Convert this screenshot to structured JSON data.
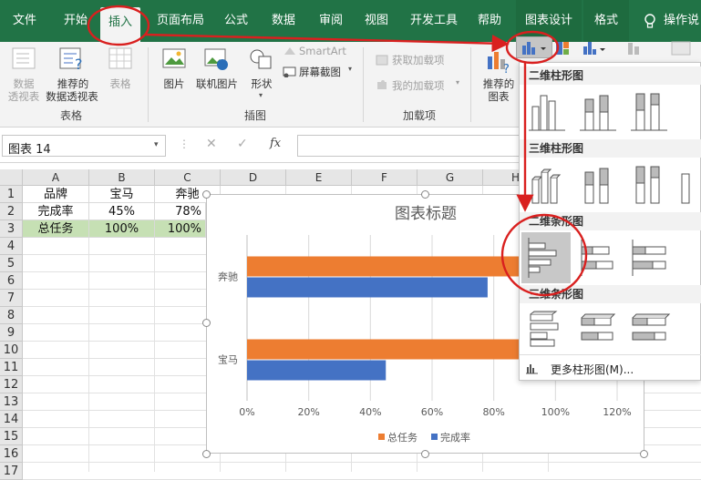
{
  "tabs": {
    "file": "文件",
    "home": "开始",
    "insert": "插入",
    "page_layout": "页面布局",
    "formulas": "公式",
    "data": "数据",
    "review": "审阅",
    "view": "视图",
    "developer": "开发工具",
    "help": "帮助",
    "chart_design": "图表设计",
    "format": "格式",
    "tell_me": "操作说"
  },
  "ribbon": {
    "pivot_table": [
      "数据",
      "透视表"
    ],
    "recommended_pivot": [
      "推荐的",
      "数据透视表"
    ],
    "table": "表格",
    "group_tables": "表格",
    "picture": "图片",
    "online_picture": "联机图片",
    "shapes": "形状",
    "smartart": "SmartArt",
    "screenshot": "屏幕截图",
    "group_illustrations": "插图",
    "get_addins": "获取加载项",
    "my_addins": "我的加载项",
    "group_addins": "加载项",
    "recommended_charts": [
      "推荐的",
      "图表"
    ]
  },
  "formula_bar": {
    "name_box": "图表 14",
    "fx": "fx"
  },
  "sheet": {
    "columns": [
      "A",
      "B",
      "C",
      "D",
      "E",
      "F",
      "G",
      "H"
    ],
    "rows": [
      "1",
      "2",
      "3",
      "4",
      "5",
      "6",
      "7",
      "8",
      "9",
      "10",
      "11",
      "12",
      "13",
      "14",
      "15",
      "16",
      "17"
    ],
    "cells": {
      "A1": "品牌",
      "B1": "宝马",
      "C1": "奔驰",
      "A2": "完成率",
      "B2": "45%",
      "C2": "78%",
      "A3": "总任务",
      "B3": "100%",
      "C3": "100%"
    }
  },
  "colors": {
    "excel_green": "#217346",
    "series_total": "#ed7d31",
    "series_completion": "#4472c4",
    "annotation_red": "#d9201f",
    "highlight_green": "#c6e0b4"
  },
  "chart_data": {
    "type": "bar",
    "orientation": "horizontal",
    "title": "图表标题",
    "categories": [
      "宝马",
      "奔驰"
    ],
    "series": [
      {
        "name": "总任务",
        "values": [
          1.0,
          1.0
        ]
      },
      {
        "name": "完成率",
        "values": [
          0.45,
          0.78
        ]
      }
    ],
    "xlim": [
      0,
      1.2
    ],
    "x_ticks": [
      "0%",
      "20%",
      "40%",
      "60%",
      "80%",
      "100%",
      "120%"
    ],
    "grid": true,
    "legend": "bottom"
  },
  "dropdown": {
    "col2d": "二维柱形图",
    "col3d": "三维柱形图",
    "bar2d": "二维条形图",
    "bar3d": "三维条形图",
    "more": "更多柱形图(M)..."
  }
}
